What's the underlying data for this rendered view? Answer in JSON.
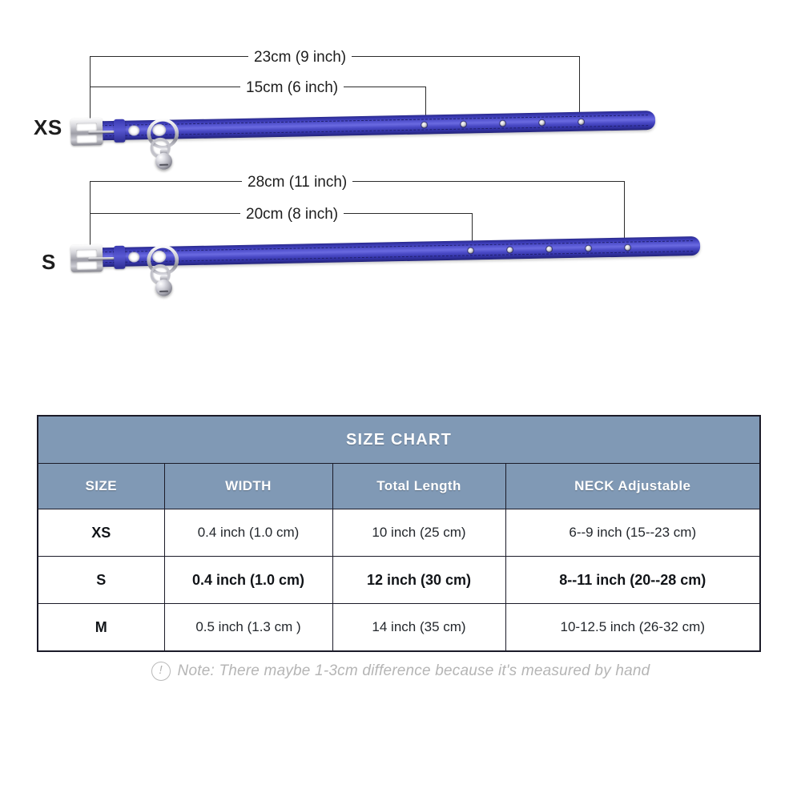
{
  "diagram": {
    "rows": [
      {
        "size_label": "XS",
        "outer_measure": "23cm (9 inch)",
        "inner_measure": "15cm (6 inch)",
        "hole_count": 5
      },
      {
        "size_label": "S",
        "outer_measure": "28cm (11 inch)",
        "inner_measure": "20cm (8 inch)",
        "hole_count": 5
      }
    ],
    "icons": {
      "buckle": "buckle-icon",
      "dring": "d-ring-icon",
      "bell": "bell-icon"
    },
    "colors": {
      "strap": "#3a3ab4",
      "strap_highlight": "#6a6ae0",
      "hardware": "#c9c9d1",
      "leader_line": "#2b2b2b"
    }
  },
  "table": {
    "title": "SIZE CHART",
    "columns": [
      "SIZE",
      "WIDTH",
      "Total Length",
      "NECK Adjustable"
    ],
    "rows": [
      {
        "size": "XS",
        "width": "0.4 inch (1.0 cm)",
        "total_length": "10 inch (25 cm)",
        "neck": "6--9 inch (15--23 cm)",
        "emphasis": false
      },
      {
        "size": "S",
        "width": "0.4 inch (1.0 cm)",
        "total_length": "12 inch (30 cm)",
        "neck": "8--11 inch (20--28 cm)",
        "emphasis": true
      },
      {
        "size": "M",
        "width": "0.5 inch (1.3 cm )",
        "total_length": "14 inch (35 cm)",
        "neck": "10-12.5 inch (26-32 cm)",
        "emphasis": false
      }
    ],
    "colors": {
      "header_bg": "#8099b5",
      "header_text": "#ffffff",
      "border": "#1b1b28",
      "body_bg": "#ffffff"
    }
  },
  "note": {
    "icon": "exclamation-circle-icon",
    "icon_glyph": "!",
    "text": "Note: There maybe 1-3cm difference because it's measured by hand",
    "color": "#b5b5b5"
  }
}
